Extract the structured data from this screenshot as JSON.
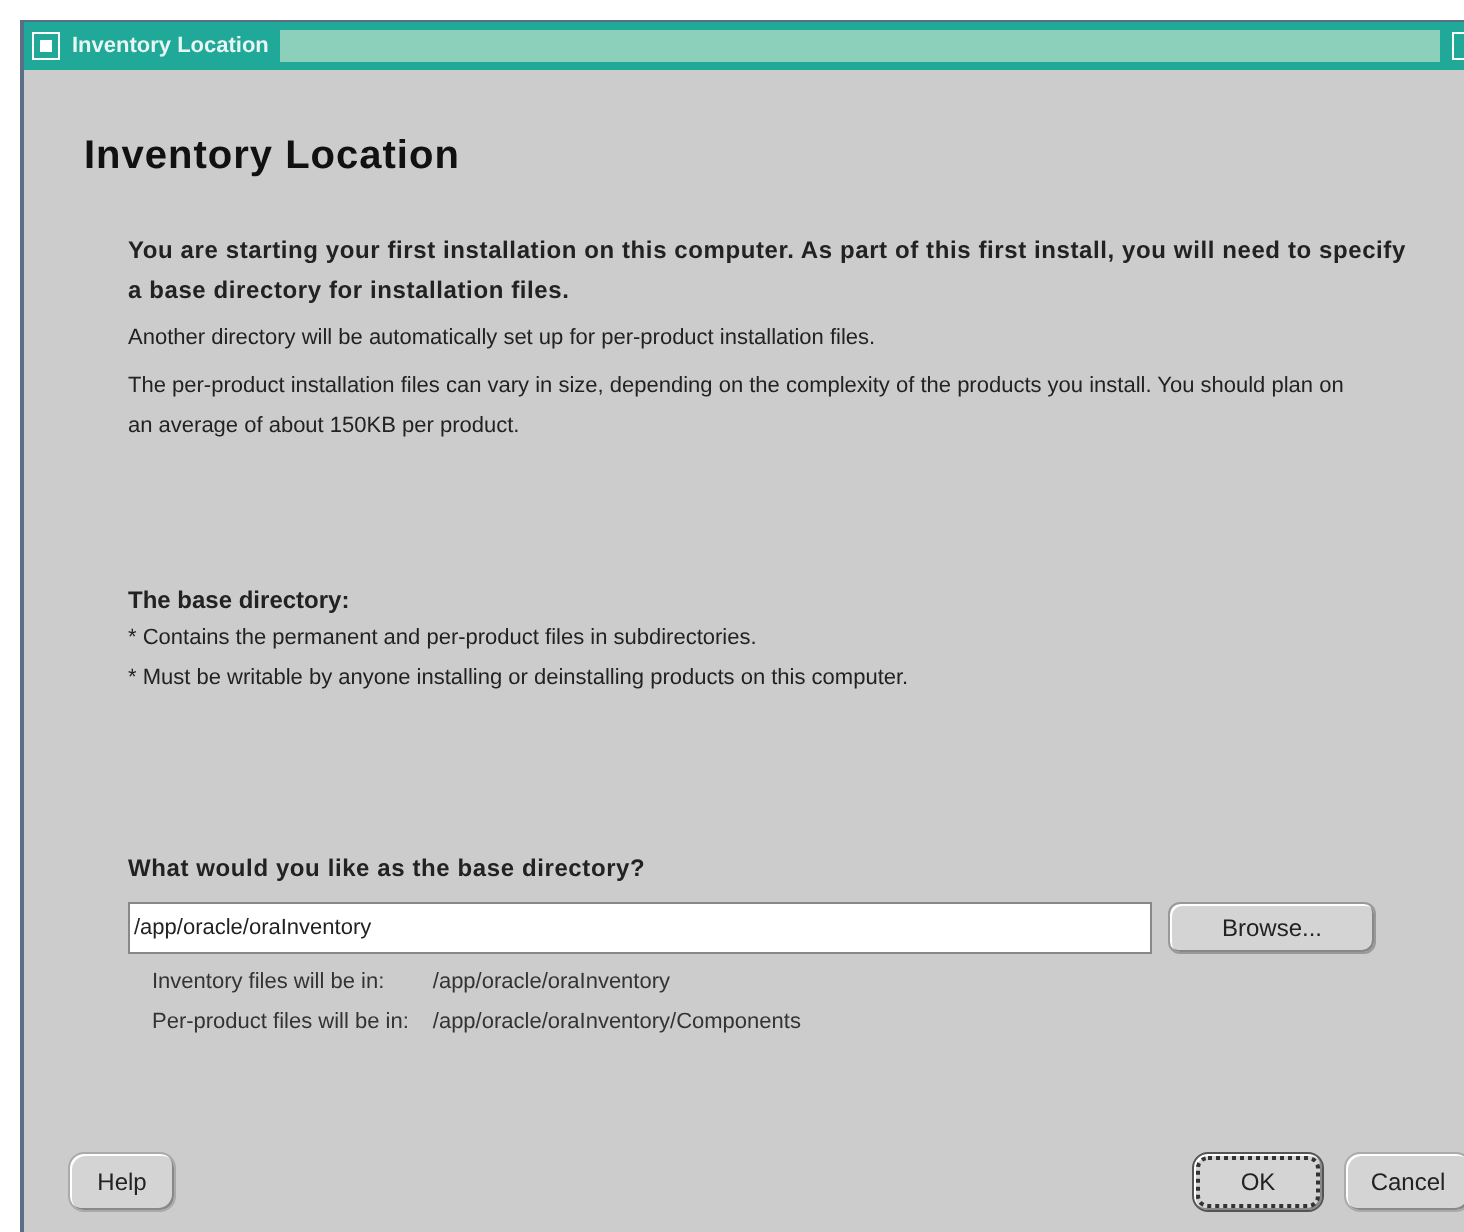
{
  "window": {
    "title": "Inventory Location"
  },
  "heading": "Inventory Location",
  "intro_bold": "You are starting your first installation on this computer. As part of this first install, you will need to specify a base directory for installation files.",
  "intro_lines": [
    "Another directory will be automatically set up for per-product installation files.",
    "The per-product installation files can vary in size, depending on the complexity of the products you install.  You should plan on an average of about 150KB per product."
  ],
  "base_heading": "The base directory:",
  "base_bullets": [
    "* Contains the permanent and per-product files in subdirectories.",
    "* Must be writable by anyone installing or deinstalling products on this computer."
  ],
  "question": "What would you like as the base directory?",
  "directory_field": {
    "value": "/app/oracle/oraInventory"
  },
  "browse_button": "Browse...",
  "info_rows": [
    {
      "label": "Inventory files will be in:",
      "value": "/app/oracle/oraInventory"
    },
    {
      "label": "Per-product files will be in:",
      "value": "/app/oracle/oraInventory/Components"
    }
  ],
  "buttons": [
    {
      "label": "Help",
      "focused": false
    },
    {
      "label": "OK",
      "focused": true
    },
    {
      "label": "Cancel",
      "focused": false
    }
  ]
}
